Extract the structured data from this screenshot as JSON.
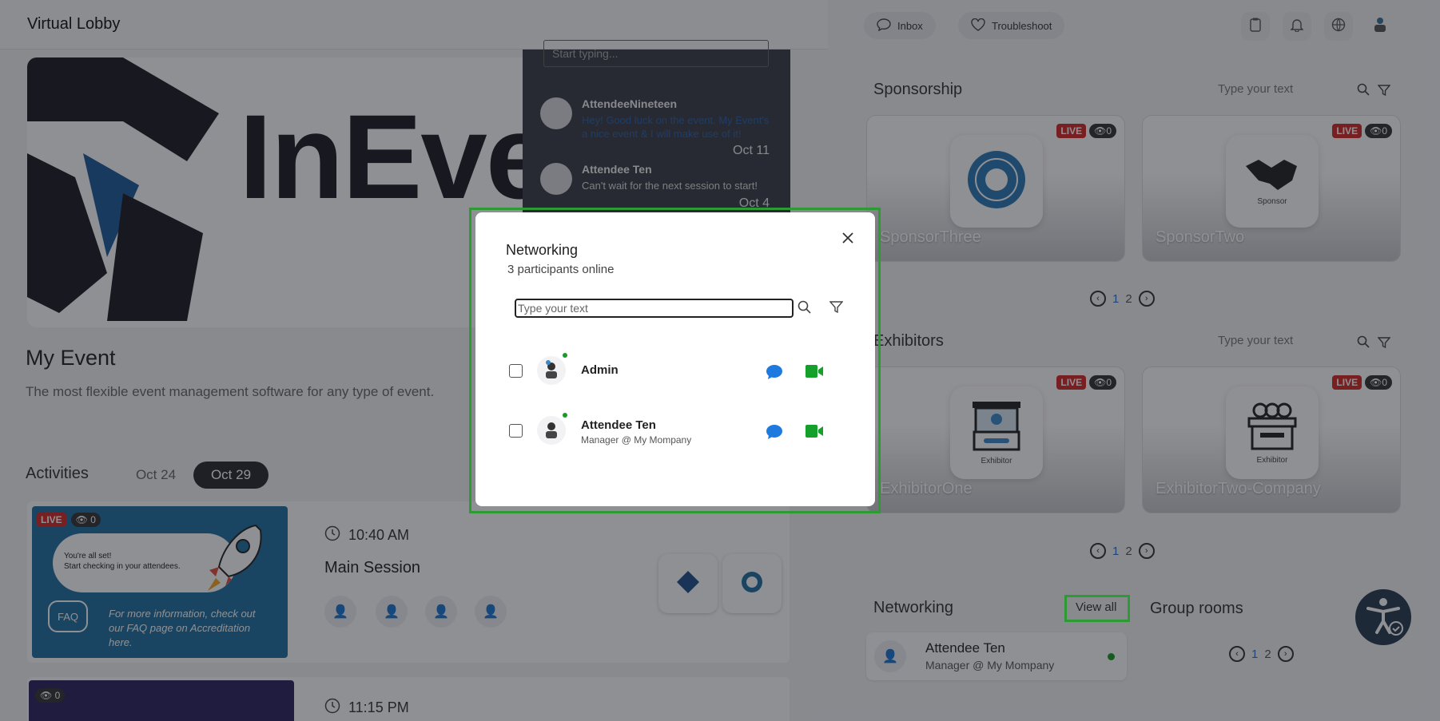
{
  "header": {
    "title": "Virtual Lobby"
  },
  "topbar": {
    "inbox": "Inbox",
    "troubleshoot": "Troubleshoot"
  },
  "banner": {
    "logo_text": "InEve"
  },
  "chat": {
    "placeholder": "Start typing...",
    "messages": [
      {
        "name": "AttendeeNineteen",
        "text": "Hey! Good luck on the event. My Event's a nice event & I will make use of it!",
        "date": "Oct 11"
      },
      {
        "name": "Attendee Ten",
        "text": "Can't wait for the next session to start!",
        "date": "Oct 4"
      }
    ]
  },
  "event": {
    "title": "My Event",
    "subtitle": "The most flexible event management software for any type of event."
  },
  "activities": {
    "title": "Activities",
    "dates": [
      "Oct 24",
      "Oct 29"
    ],
    "selected": "Oct 29",
    "sessions": [
      {
        "time": "10:40 AM",
        "name": "Main Session",
        "live": "LIVE",
        "views": "0",
        "thumb_text_1": "You're all set!",
        "thumb_text_2": "Start checking in your attendees.",
        "thumb_faq": "FAQ",
        "thumb_info": "For more information, check out our FAQ page on Accreditation here."
      },
      {
        "time": "11:15 PM",
        "views": "0"
      }
    ]
  },
  "sponsorship": {
    "title": "Sponsorship",
    "search_placeholder": "Type your text",
    "cards": [
      {
        "name": "SponsorThree",
        "live": "LIVE",
        "views": "0"
      },
      {
        "name": "SponsorTwo",
        "live": "LIVE",
        "views": "0",
        "logo_label": "Sponsor"
      }
    ],
    "pages": [
      "1",
      "2"
    ]
  },
  "exhibitors": {
    "title": "Exhibitors",
    "search_placeholder": "Type your text",
    "cards": [
      {
        "name": "ExhibitorOne",
        "live": "LIVE",
        "views": "0",
        "logo_label": "Exhibitor"
      },
      {
        "name": "ExhibitorTwo-Company",
        "live": "LIVE",
        "views": "0",
        "logo_label": "Exhibitor"
      }
    ],
    "pages": [
      "1",
      "2"
    ]
  },
  "networking_section": {
    "title": "Networking",
    "view_all": "View all",
    "person": {
      "name": "Attendee Ten",
      "subtitle": "Manager @ My Mompany"
    }
  },
  "group_rooms": {
    "title": "Group rooms",
    "pages": [
      "1",
      "2"
    ]
  },
  "modal": {
    "title": "Networking",
    "subtitle": "3 participants online",
    "search_placeholder": "Type your text",
    "participants": [
      {
        "name": "Admin",
        "subtitle": ""
      },
      {
        "name": "Attendee Ten",
        "subtitle": "Manager @ My Mompany"
      }
    ]
  },
  "colors": {
    "accent_green": "#2d9b34",
    "chat_blue": "#1f7ae0",
    "video_green": "#14a02a",
    "live_red": "#d42828"
  }
}
